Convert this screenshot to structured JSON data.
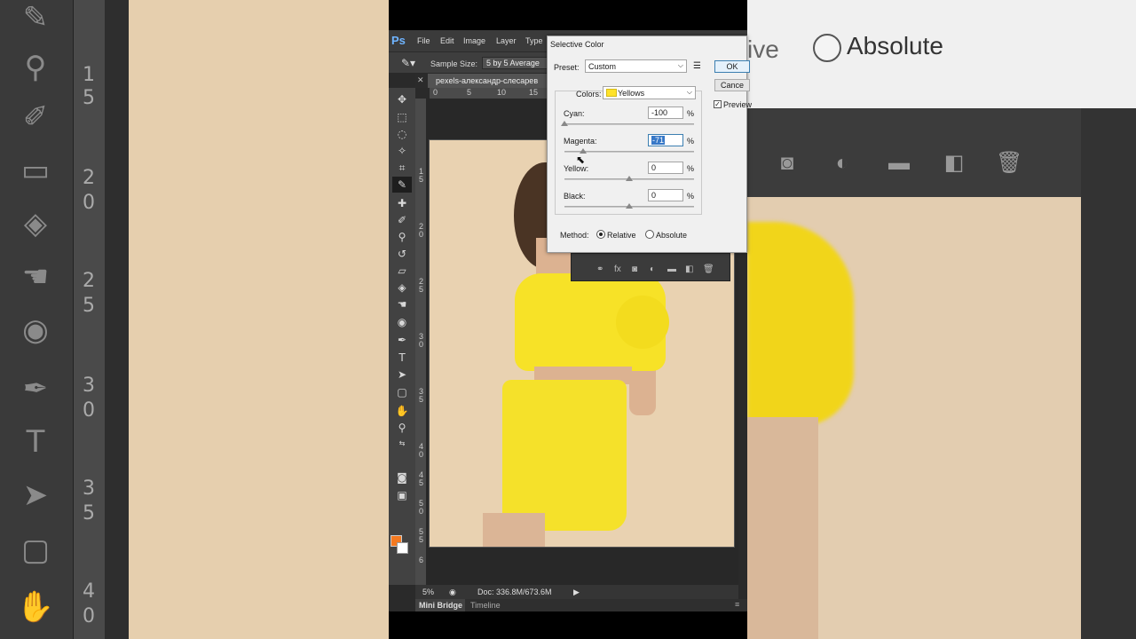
{
  "bg_left": {
    "ruler_labels": [
      "1",
      "5",
      "2",
      "0",
      "2",
      "5",
      "3",
      "0",
      "3",
      "5",
      "4",
      "0"
    ],
    "icons": [
      "pen-icon",
      "stamp-icon",
      "brush-icon",
      "eraser-icon",
      "paint-bucket-icon",
      "smudge-icon",
      "dodge-icon",
      "pen-tool-icon",
      "type-icon",
      "path-select-icon",
      "rectangle-icon",
      "hand-icon"
    ]
  },
  "bg_right": {
    "partial_label": "ive",
    "absolute_label": "Absolute"
  },
  "ps": {
    "logo": "Ps",
    "menu": [
      "File",
      "Edit",
      "Image",
      "Layer",
      "Type"
    ],
    "sample_size_label": "Sample Size:",
    "sample_size_value": "5 by 5 Average",
    "doc_tab": "pexels-александр-слесарев",
    "hruler": [
      "0",
      "5",
      "10",
      "15"
    ],
    "vruler": [
      "1",
      "5",
      "2",
      "0",
      "2",
      "5",
      "3",
      "0",
      "3",
      "5",
      "4",
      "0",
      "4",
      "5",
      "5",
      "0",
      "5",
      "5",
      "6"
    ],
    "zoom": "5%",
    "doc_size": "Doc: 336.8M/673.6M",
    "bottom_tabs": [
      "Mini Bridge",
      "Timeline"
    ],
    "foreground_color": "#f47920",
    "background_color": "#ffffff"
  },
  "dialog": {
    "title": "Selective Color",
    "preset_label": "Preset:",
    "preset_value": "Custom",
    "ok_label": "OK",
    "cancel_label": "Cance",
    "preview_label": "Preview",
    "preview_checked": true,
    "colors_label": "Colors:",
    "colors_value": "Yellows",
    "sliders": [
      {
        "label": "Cyan:",
        "value": "-100",
        "percent": -100
      },
      {
        "label": "Magenta:",
        "value": "-71",
        "percent": -71
      },
      {
        "label": "Yellow:",
        "value": "0",
        "percent": 0
      },
      {
        "label": "Black:",
        "value": "0",
        "percent": 0
      }
    ],
    "pct_sign": "%",
    "method_label": "Method:",
    "relative_label": "Relative",
    "absolute_label": "Absolute",
    "method_selected": "Relative"
  }
}
